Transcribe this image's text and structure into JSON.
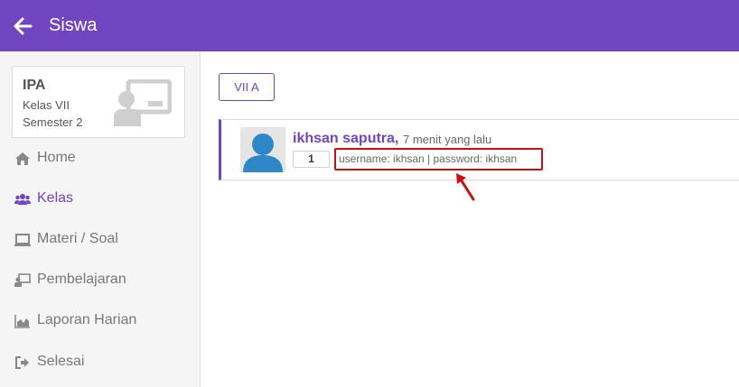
{
  "header": {
    "title": "Siswa",
    "background_color": "#7144c0",
    "back_icon": "arrow-left-icon"
  },
  "course": {
    "name": "IPA",
    "class_label": "Kelas VII",
    "semester_label": "Semester 2",
    "icon": "teacher-board-icon"
  },
  "sidebar": {
    "items": [
      {
        "label": "Home",
        "icon": "home-icon",
        "active": false
      },
      {
        "label": "Kelas",
        "icon": "users-icon",
        "active": true
      },
      {
        "label": "Materi / Soal",
        "icon": "laptop-icon",
        "active": false
      },
      {
        "label": "Pembelajaran",
        "icon": "teacher-board-icon",
        "active": false
      },
      {
        "label": "Laporan Harian",
        "icon": "area-chart-icon",
        "active": false
      },
      {
        "label": "Selesai",
        "icon": "sign-out-icon",
        "active": false
      }
    ]
  },
  "main": {
    "class_filter_label": "VII A",
    "student": {
      "name": "ikhsan saputra,",
      "time": "7 menit yang lalu",
      "count": "1",
      "separator": "|",
      "credentials": "username: ikhsan | password: ikhsan"
    },
    "annotation": {
      "color": "#c81010"
    }
  }
}
